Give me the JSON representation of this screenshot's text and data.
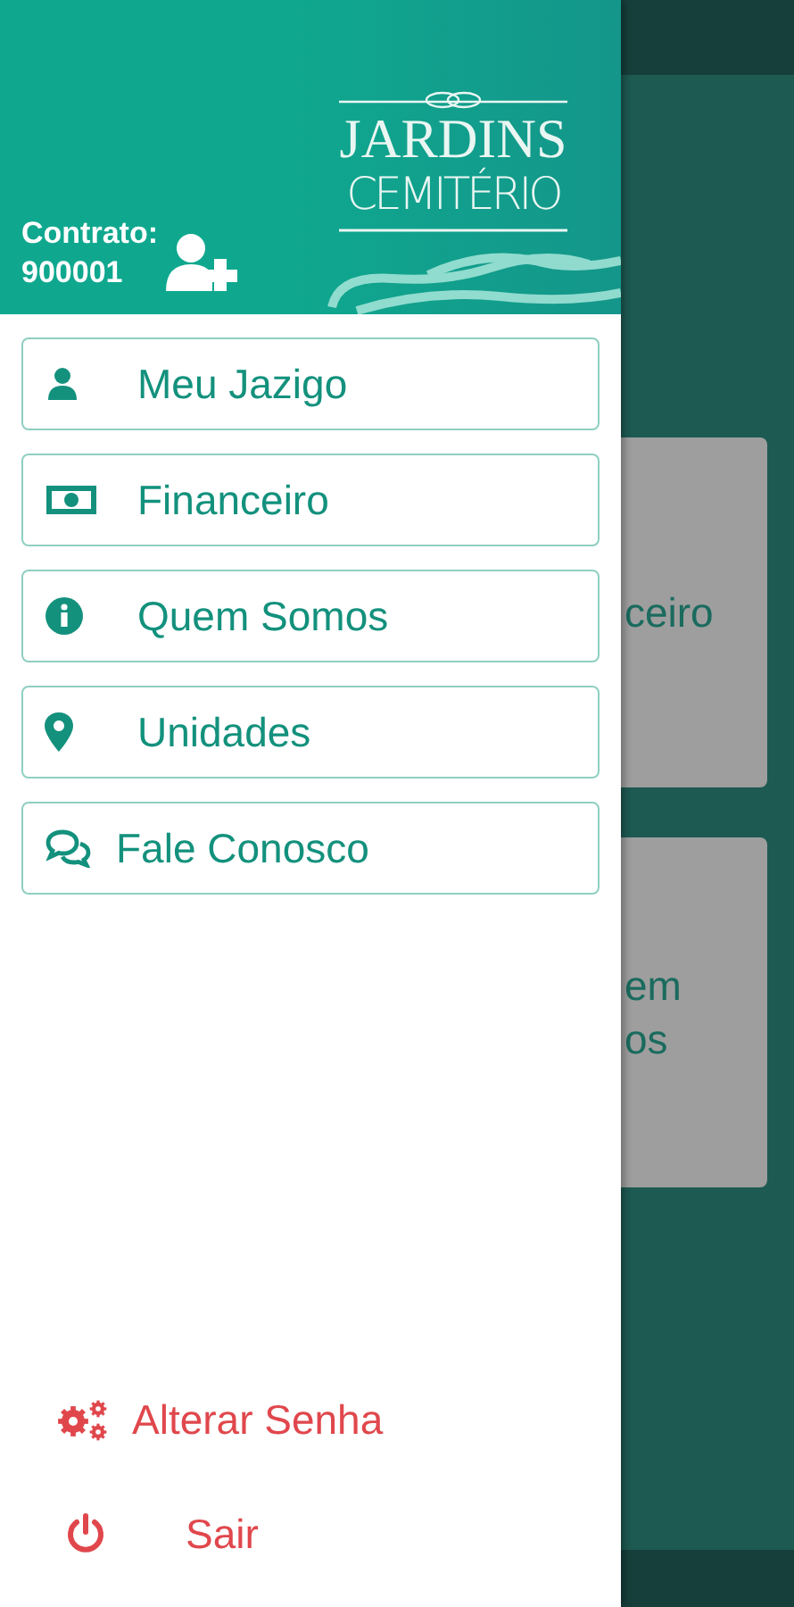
{
  "header": {
    "logo_title": "JARDINS",
    "logo_subtitle": "CEMITÉRIO",
    "contract_label": "Contrato:",
    "contract_number": "900001"
  },
  "menu": [
    {
      "label": "Meu Jazigo"
    },
    {
      "label": "Financeiro"
    },
    {
      "label": "Quem Somos"
    },
    {
      "label": "Unidades"
    },
    {
      "label": "Fale Conosco"
    }
  ],
  "footer_actions": [
    {
      "label": "Alterar Senha"
    },
    {
      "label": "Sair"
    }
  ],
  "background_cards": [
    {
      "lines": [
        "ceiro"
      ]
    },
    {
      "lines": [
        "em",
        "os"
      ]
    }
  ]
}
